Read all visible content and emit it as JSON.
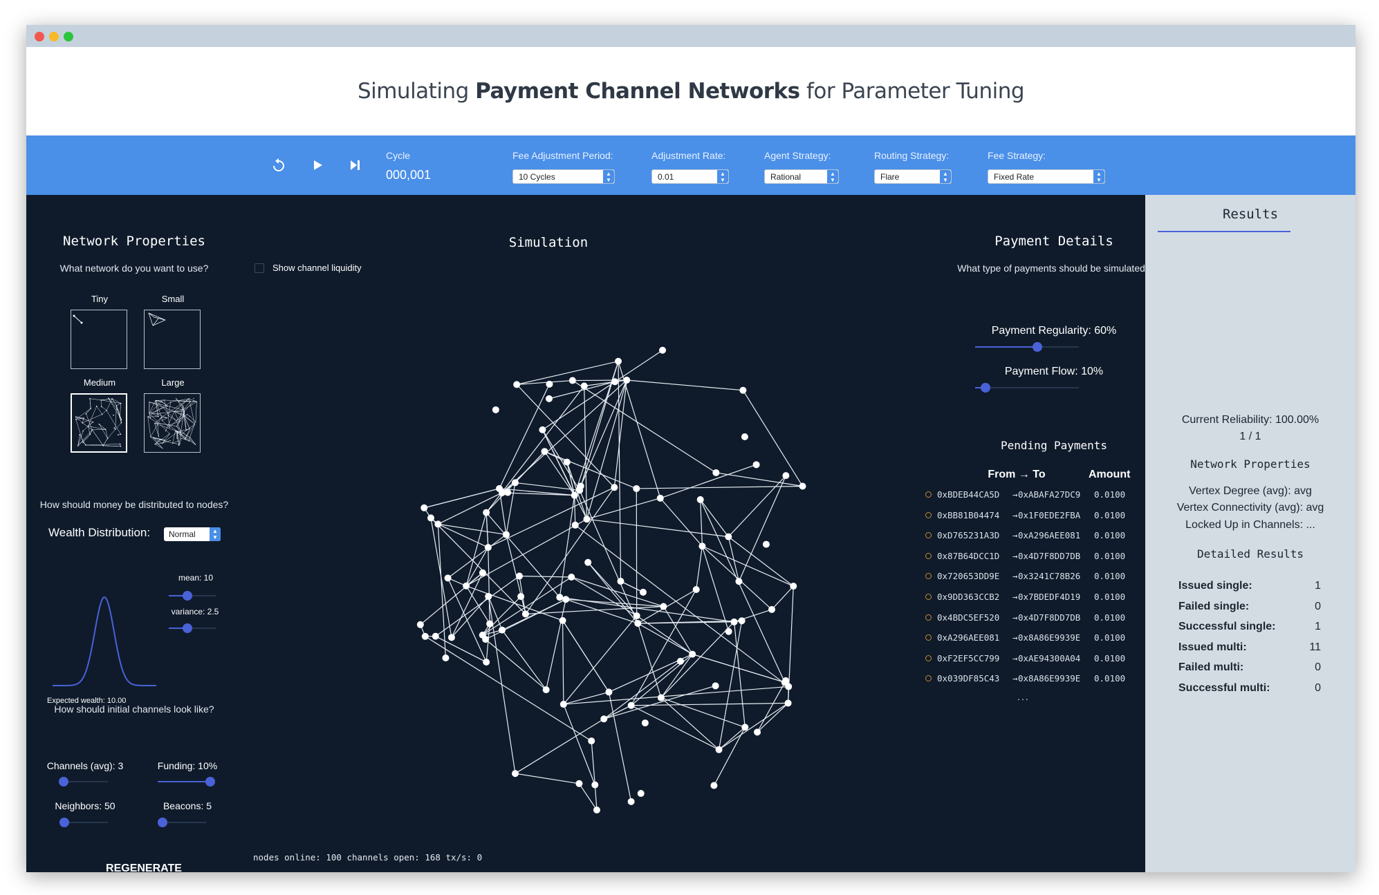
{
  "header": {
    "title_prefix": "Simulating ",
    "title_bold": "Payment Channel Networks",
    "title_suffix": " for Parameter Tuning"
  },
  "toolbar": {
    "cycle_label": "Cycle",
    "cycle_value": "000,001",
    "fee_period_label": "Fee Adjustment Period:",
    "fee_period_value": "10 Cycles",
    "adj_rate_label": "Adjustment Rate:",
    "adj_rate_value": "0.01",
    "agent_label": "Agent Strategy:",
    "agent_value": "Rational",
    "routing_label": "Routing Strategy:",
    "routing_value": "Flare",
    "fee_strategy_label": "Fee Strategy:",
    "fee_strategy_value": "Fixed Rate"
  },
  "network": {
    "title": "Network Properties",
    "question": "What network do you want to use?",
    "sizes": [
      {
        "label": "Tiny",
        "selected": false
      },
      {
        "label": "Small",
        "selected": false
      },
      {
        "label": "Medium",
        "selected": true
      },
      {
        "label": "Large",
        "selected": false
      }
    ],
    "money_question": "How should money be distributed to nodes?",
    "wealth_label": "Wealth Distribution:",
    "wealth_value": "Normal",
    "mean_label": "mean: 10",
    "mean_value": 10,
    "variance_label": "variance: 2.5",
    "variance_value": 2.5,
    "expected_label": "Expected wealth: 10.00",
    "channels_question": "How should initial channels look like?",
    "channels_label": "Channels (avg): 3",
    "channels_value": 3,
    "funding_label": "Funding: 10%",
    "funding_value": 10,
    "neighbors_label": "Neighbors: 50",
    "neighbors_value": 50,
    "beacons_label": "Beacons: 5",
    "beacons_value": 5,
    "regenerate": "REGENERATE"
  },
  "simulation": {
    "title": "Simulation",
    "show_liquidity": "Show channel liquidity",
    "status": "nodes online: 100 channels open: 168 tx/s: 0"
  },
  "payments": {
    "title": "Payment Details",
    "question": "What type of payments should be simulated?",
    "regularity_label": "Payment Regularity: 60%",
    "regularity_value": 60,
    "flow_label": "Payment Flow: 10%",
    "flow_value": 10,
    "pending_title": "Pending Payments",
    "col_from_to": "From → To",
    "col_amount": "Amount",
    "rows": [
      {
        "from": "0xBDEB44CA5D",
        "to": "0xABAFA27DC9",
        "amount": "0.0100"
      },
      {
        "from": "0xBB81B04474",
        "to": "0x1F0EDE2FBA",
        "amount": "0.0100"
      },
      {
        "from": "0xD765231A3D",
        "to": "0xA296AEE081",
        "amount": "0.0100"
      },
      {
        "from": "0x87B64DCC1D",
        "to": "0x4D7F8DD7DB",
        "amount": "0.0100"
      },
      {
        "from": "0x720653DD9E",
        "to": "0x3241C78B26",
        "amount": "0.0100"
      },
      {
        "from": "0x9DD363CCB2",
        "to": "0x7BDEDF4D19",
        "amount": "0.0100"
      },
      {
        "from": "0x4BDC5EF520",
        "to": "0x4D7F8DD7DB",
        "amount": "0.0100"
      },
      {
        "from": "0xA296AEE081",
        "to": "0x8A86E9939E",
        "amount": "0.0100"
      },
      {
        "from": "0xF2EF5CC799",
        "to": "0xAE94300A04",
        "amount": "0.0100"
      },
      {
        "from": "0x039DF85C43",
        "to": "0x8A86E9939E",
        "amount": "0.0100"
      }
    ],
    "more": "..."
  },
  "results": {
    "title": "Results",
    "reliability": "Current Reliability: 100.00%",
    "ratio": "1 / 1",
    "net_props_title": "Network Properties",
    "vertex_degree": "Vertex Degree (avg): avg",
    "vertex_conn": "Vertex Connectivity (avg): avg",
    "locked": "Locked Up in Channels: ...",
    "detailed_title": "Detailed Results",
    "rows": [
      {
        "label": "Issued single:",
        "value": "1"
      },
      {
        "label": "Failed single:",
        "value": "0"
      },
      {
        "label": "Successful single:",
        "value": "1"
      },
      {
        "label": "Issued multi:",
        "value": "11"
      },
      {
        "label": "Failed multi:",
        "value": "0"
      },
      {
        "label": "Successful multi:",
        "value": "0"
      }
    ]
  },
  "colors": {
    "toolbar": "#4a8fe8",
    "panel": "#0f1b2b",
    "results_bg": "#d3dce3",
    "accent": "#4a62d8",
    "pending_bullet": "#c48a2a"
  }
}
